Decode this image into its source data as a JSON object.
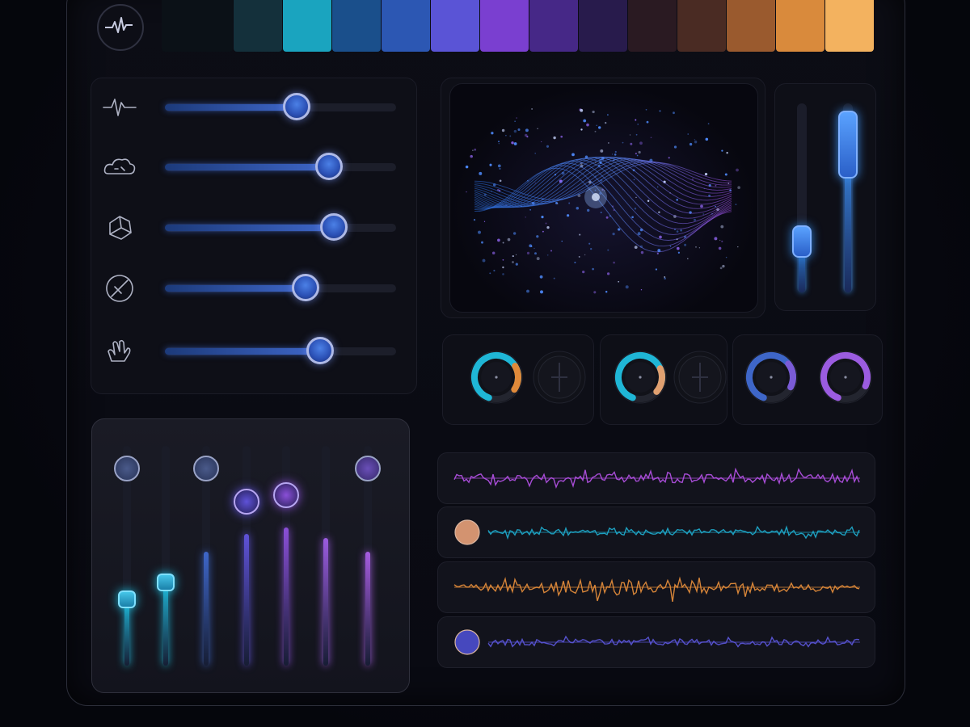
{
  "colors": {
    "accent_blue": "#3e66c8",
    "accent_cyan": "#1fb6d6",
    "accent_purple": "#9b5ce0",
    "accent_orange": "#e08a3a",
    "accent_peach": "#e8a17a"
  },
  "palette": {
    "swatches": [
      "#0b1117",
      "#14303b",
      "#1aa4bf",
      "#1a4f8b",
      "#2c57b3",
      "#5a54d6",
      "#7a3fd0",
      "#462887",
      "#281b4c",
      "#2a1a22",
      "#4a2b23",
      "#9a5a2e",
      "#d98a3c",
      "#f3b25f"
    ]
  },
  "app": {
    "logo_icon": "waveform-logo-icon"
  },
  "effect_sliders": [
    {
      "icon": "pulse-icon",
      "value": 0.57
    },
    {
      "icon": "cloud-icon",
      "value": 0.71
    },
    {
      "icon": "cube-icon",
      "value": 0.73
    },
    {
      "icon": "slash-circle-icon",
      "value": 0.61
    },
    {
      "icon": "hand-icon",
      "value": 0.67
    }
  ],
  "visualizer": {
    "icon": "waveform-visualizer"
  },
  "vertical_sliders": [
    {
      "value": 0.27,
      "color": "#2f7fd8"
    },
    {
      "value": 0.78,
      "color": "#3a8ae6"
    }
  ],
  "knob_groups": [
    {
      "knobs": [
        {
          "value": 0.72,
          "color": "#1fb6d6",
          "secondary": "#e08a3a"
        },
        {
          "value": 0,
          "color": "#2a2c38"
        }
      ]
    },
    {
      "knobs": [
        {
          "value": 0.74,
          "color": "#1fb6d6",
          "secondary": "#e0a070"
        },
        {
          "value": 0,
          "color": "#2a2c38"
        }
      ]
    },
    {
      "knobs": [
        {
          "value": 0.7,
          "color": "#3e66c8",
          "secondary": "#7a5bd6"
        },
        {
          "value": 0.76,
          "color": "#9b5ce0"
        }
      ]
    }
  ],
  "faders": [
    {
      "value": 0.3,
      "color": "#1fb6d6",
      "cap": "square"
    },
    {
      "value": 0.38,
      "color": "#1fb6d6",
      "cap": "square"
    },
    {
      "value": 0.52,
      "color": "#3e66c8",
      "cap": "none"
    },
    {
      "value": 0.6,
      "color": "#5f52d8",
      "cap": "round"
    },
    {
      "value": 0.63,
      "color": "#8a4fd8",
      "cap": "round"
    },
    {
      "value": 0.58,
      "color": "#9b5ce0",
      "cap": "none"
    },
    {
      "value": 0.52,
      "color": "#a65ce0",
      "cap": "none"
    }
  ],
  "tracks": [
    {
      "color": "#b04fe0",
      "has_dot": false
    },
    {
      "color": "#1fa6c8",
      "has_dot": true,
      "dot_color": "#e8a17a"
    },
    {
      "color": "#e08a3a",
      "has_dot": false
    },
    {
      "color": "#5a54d6",
      "has_dot": true,
      "dot_color": "#4c4ed0"
    }
  ]
}
